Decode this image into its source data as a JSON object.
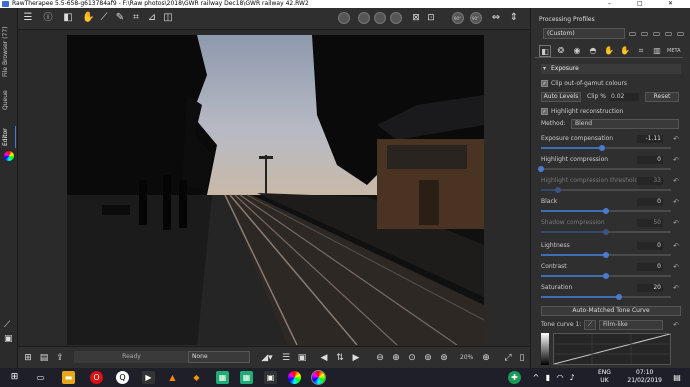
{
  "window": {
    "title": "RawTherapee 5.5-658-g613784af9 - F:\\Raw photos\\2018\\GWR railway Dec18\\GWR railway 42.RW2",
    "min": "–",
    "max": "□",
    "close": "✕"
  },
  "left_tabs": {
    "file_browser": "File Browser (77)",
    "queue": "Queue",
    "editor": "Editor"
  },
  "toolbar": {
    "zoom_labels": [
      "90°",
      "90°"
    ]
  },
  "status": {
    "text": "Ready",
    "zoom": "20%",
    "preview_mode": "None"
  },
  "right_panel": {
    "title": "Processing Profiles",
    "profile": "(Custom)",
    "section": "Exposure",
    "clip_gamut": "Clip out-of-gamut colours",
    "auto_levels": "Auto Levels",
    "clip_label": "Clip %",
    "clip_value": "0.02",
    "reset": "Reset",
    "highlight_recon": "Highlight reconstruction",
    "method_label": "Method:",
    "method_value": "Blend",
    "exposure_comp_label": "Exposure compensation",
    "exposure_comp": "-1.11",
    "hl_comp_label": "Highlight compression",
    "hl_comp": "0",
    "hl_thresh_label": "Highlight compression threshold",
    "hl_thresh": "33",
    "black_label": "Black",
    "black": "0",
    "shadow_label": "Shadow compression",
    "shadow": "50",
    "lightness_label": "Lightness",
    "lightness": "0",
    "contrast_label": "Contrast",
    "contrast": "0",
    "saturation_label": "Saturation",
    "saturation": "20",
    "auto_tone": "Auto-Matched Tone Curve",
    "tone_curve_label": "Tone curve 1:",
    "tone_curve_type": "Film-like"
  },
  "levels": {
    "exposure_comp": 0.47,
    "hl_comp": 0.0,
    "hl_thresh": 0.13,
    "black": 0.5,
    "shadow": 0.5,
    "lightness": 0.5,
    "contrast": 0.5,
    "saturation": 0.6
  },
  "taskbar": {
    "time": "07:10",
    "date": "21/02/2019",
    "lang1": "ENG",
    "lang2": "UK"
  }
}
